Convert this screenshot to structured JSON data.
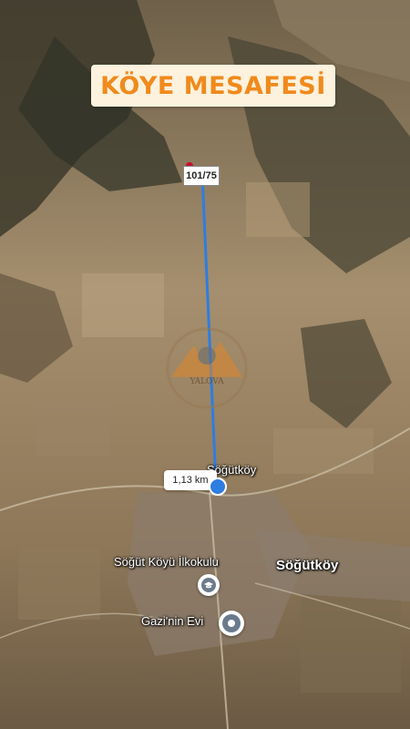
{
  "title": "KÖYE MESAFESİ",
  "parcel_label": "101/75",
  "distance": "1,13 km",
  "places": {
    "village_small": "Söğütköy",
    "village_big": "Söğütköy",
    "school": "Söğüt Köyü İlkokulu",
    "house": "Gazi'nin Evi"
  },
  "watermark": "YALOVA",
  "colors": {
    "title_text": "#f08a1c",
    "title_bg": "#fdf2dd",
    "route_line": "#2e7de0"
  },
  "icons": [
    "school-icon",
    "location-pin-icon",
    "parcel-marker-icon"
  ]
}
